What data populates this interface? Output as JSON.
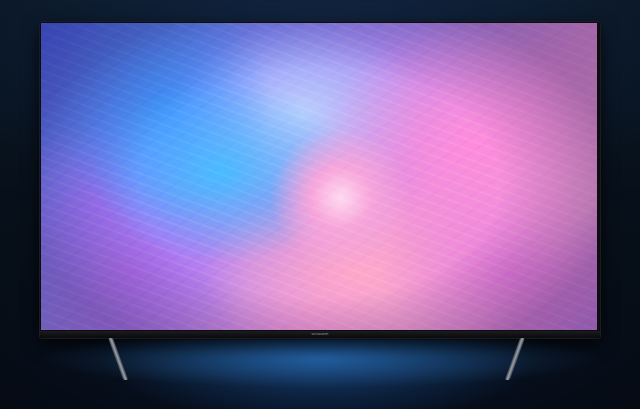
{
  "scene": {
    "subject": "tv",
    "screen_wallpaper": "abstract-color-burst",
    "colors": {
      "background": "#07101a",
      "bezel": "#0d0d10",
      "screen_pink": "#f3a3d6",
      "screen_blue": "#4696ff",
      "screen_purple": "#b08af0"
    }
  },
  "tv": {
    "brand_label": "SKYWORTH"
  }
}
